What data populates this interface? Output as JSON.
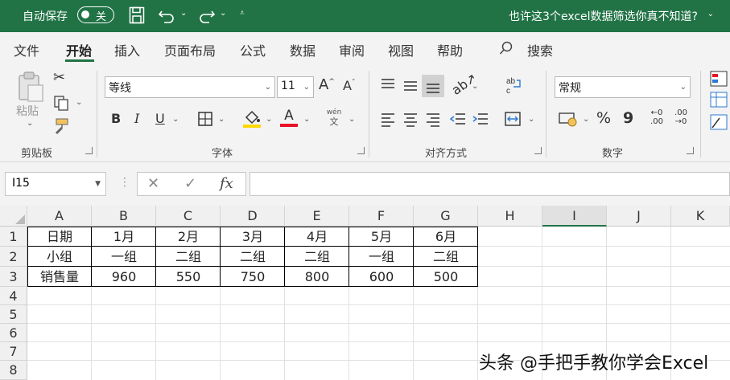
{
  "titlebar": {
    "autosave_label": "自动保存",
    "autosave_state": "关",
    "doc_title": "也许这3个excel数据筛选你真不知道?",
    "title_caret": "⌄"
  },
  "menu": [
    "文件",
    "开始",
    "插入",
    "页面布局",
    "公式",
    "数据",
    "审阅",
    "视图",
    "帮助"
  ],
  "search_label": "搜索",
  "ribbon": {
    "clipboard": {
      "label": "剪贴板",
      "paste": "粘贴"
    },
    "font": {
      "label": "字体",
      "name": "等线",
      "size": "11",
      "bold": "B",
      "italic": "I",
      "underline": "U",
      "phonetic_top": "wén",
      "phonetic_bottom": "文",
      "grow": "A",
      "shrink": "A",
      "font_color_glyph": "A"
    },
    "alignment": {
      "label": "对齐方式"
    },
    "number": {
      "label": "数字",
      "format": "常规",
      "percent": "%",
      "comma": "9",
      "inc_decimal": "←0 .00",
      "dec_decimal": ".00 →0"
    }
  },
  "formula_bar": {
    "namebox": "I15",
    "cancel": "✕",
    "enter": "✓",
    "fx": "fx",
    "value": ""
  },
  "columns": [
    "A",
    "B",
    "C",
    "D",
    "E",
    "F",
    "G",
    "H",
    "I",
    "J",
    "K"
  ],
  "selected_column": "I",
  "rows": [
    "1",
    "2",
    "3",
    "4",
    "5",
    "6",
    "7",
    "8"
  ],
  "table": [
    [
      "日期",
      "1月",
      "2月",
      "3月",
      "4月",
      "5月",
      "6月"
    ],
    [
      "小组",
      "一组",
      "二组",
      "二组",
      "二组",
      "一组",
      "二组"
    ],
    [
      "销售量",
      "960",
      "550",
      "750",
      "800",
      "600",
      "500"
    ]
  ],
  "watermark": "头条 @手把手教你学会Excel",
  "colors": {
    "accent": "#217346",
    "ribbon_bg": "#f3f3f3",
    "fill_yellow": "#ffd800",
    "font_red": "#e81123"
  }
}
